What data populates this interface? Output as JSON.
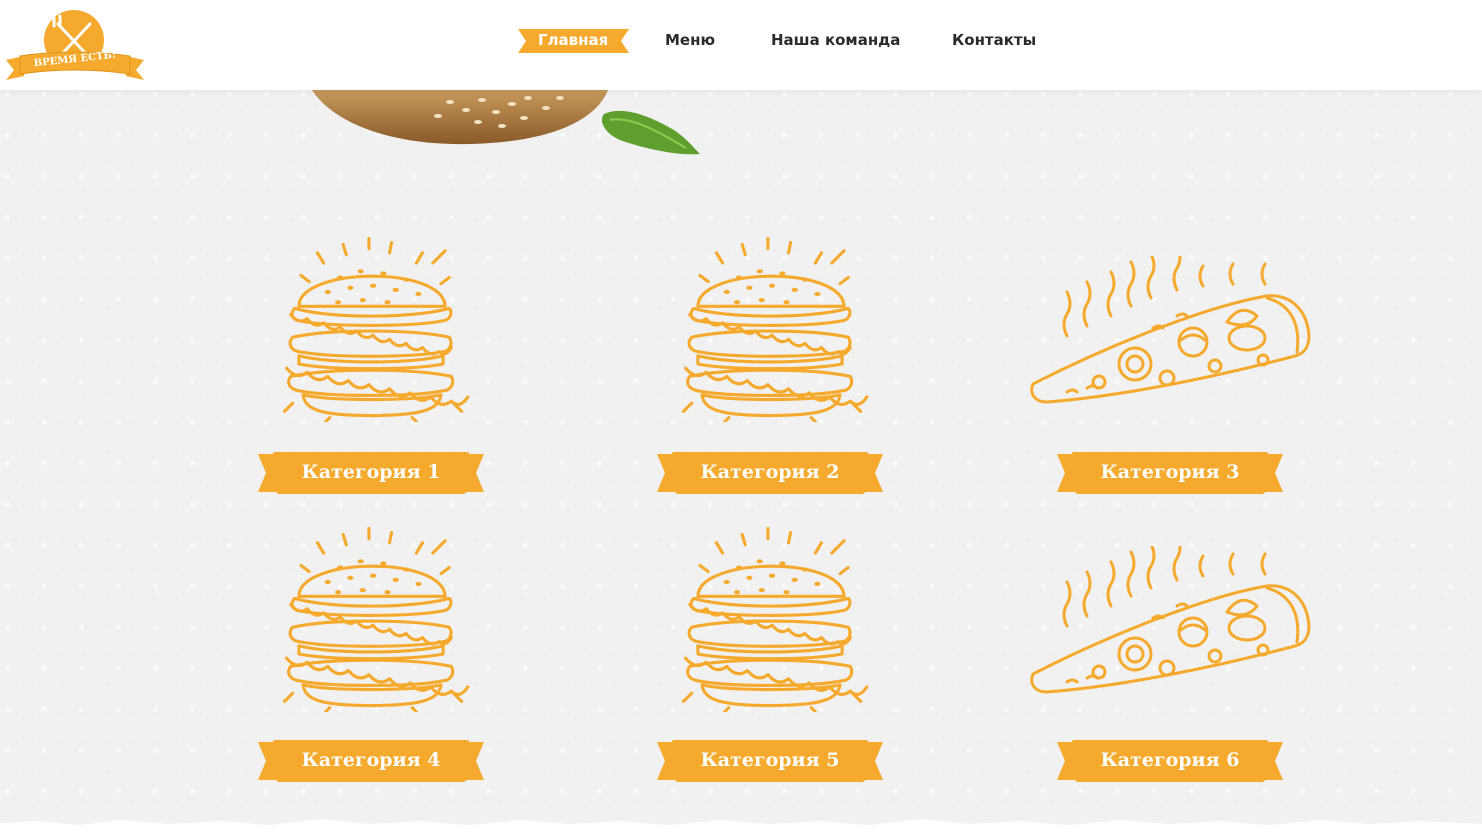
{
  "brand": {
    "logo_text": "ВРЕМЯ ЕСТЬ!",
    "accent": "#f5aa2d"
  },
  "nav": {
    "items": [
      {
        "label": "Главная",
        "active": true
      },
      {
        "label": "Меню",
        "active": false
      },
      {
        "label": "Наша команда",
        "active": false
      },
      {
        "label": "Контакты",
        "active": false
      }
    ]
  },
  "categories": [
    {
      "label": "Категория 1",
      "icon": "burger-icon"
    },
    {
      "label": "Категория 2",
      "icon": "burger-icon"
    },
    {
      "label": "Категория 3",
      "icon": "pizza-icon"
    },
    {
      "label": "Категория 4",
      "icon": "burger-icon"
    },
    {
      "label": "Категория 5",
      "icon": "burger-icon"
    },
    {
      "label": "Категория 6",
      "icon": "pizza-icon"
    }
  ]
}
